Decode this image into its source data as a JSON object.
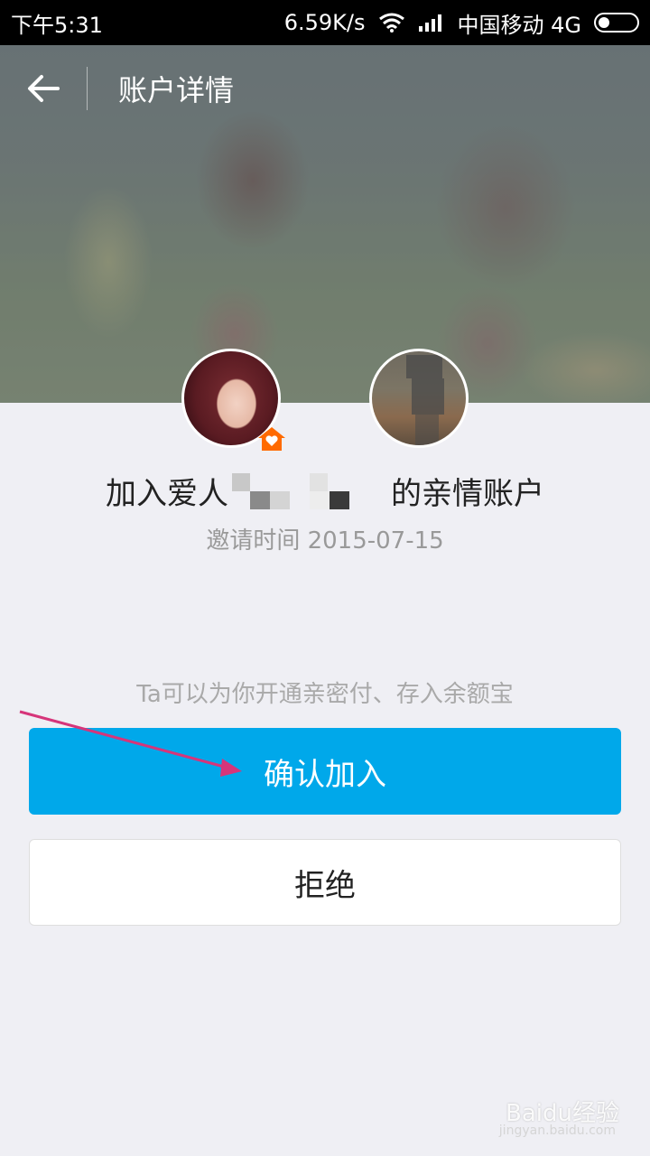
{
  "status_bar": {
    "time": "下午5:31",
    "speed": "6.59K/s",
    "carrier": "中国移动 4G"
  },
  "header": {
    "title": "账户详情"
  },
  "invite": {
    "prefix": "加入爱人",
    "suffix": "的亲情账户",
    "date": "邀请时间 2015-07-15"
  },
  "hint": "Ta可以为你开通亲密付、存入余额宝",
  "buttons": {
    "confirm": "确认加入",
    "reject": "拒绝"
  },
  "watermark": {
    "main": "Baidu经验",
    "sub": "jingyan.baidu.com"
  },
  "colors": {
    "accent": "#00a8ea",
    "badge": "#ff6a00",
    "annotation_arrow": "#d6357a"
  }
}
